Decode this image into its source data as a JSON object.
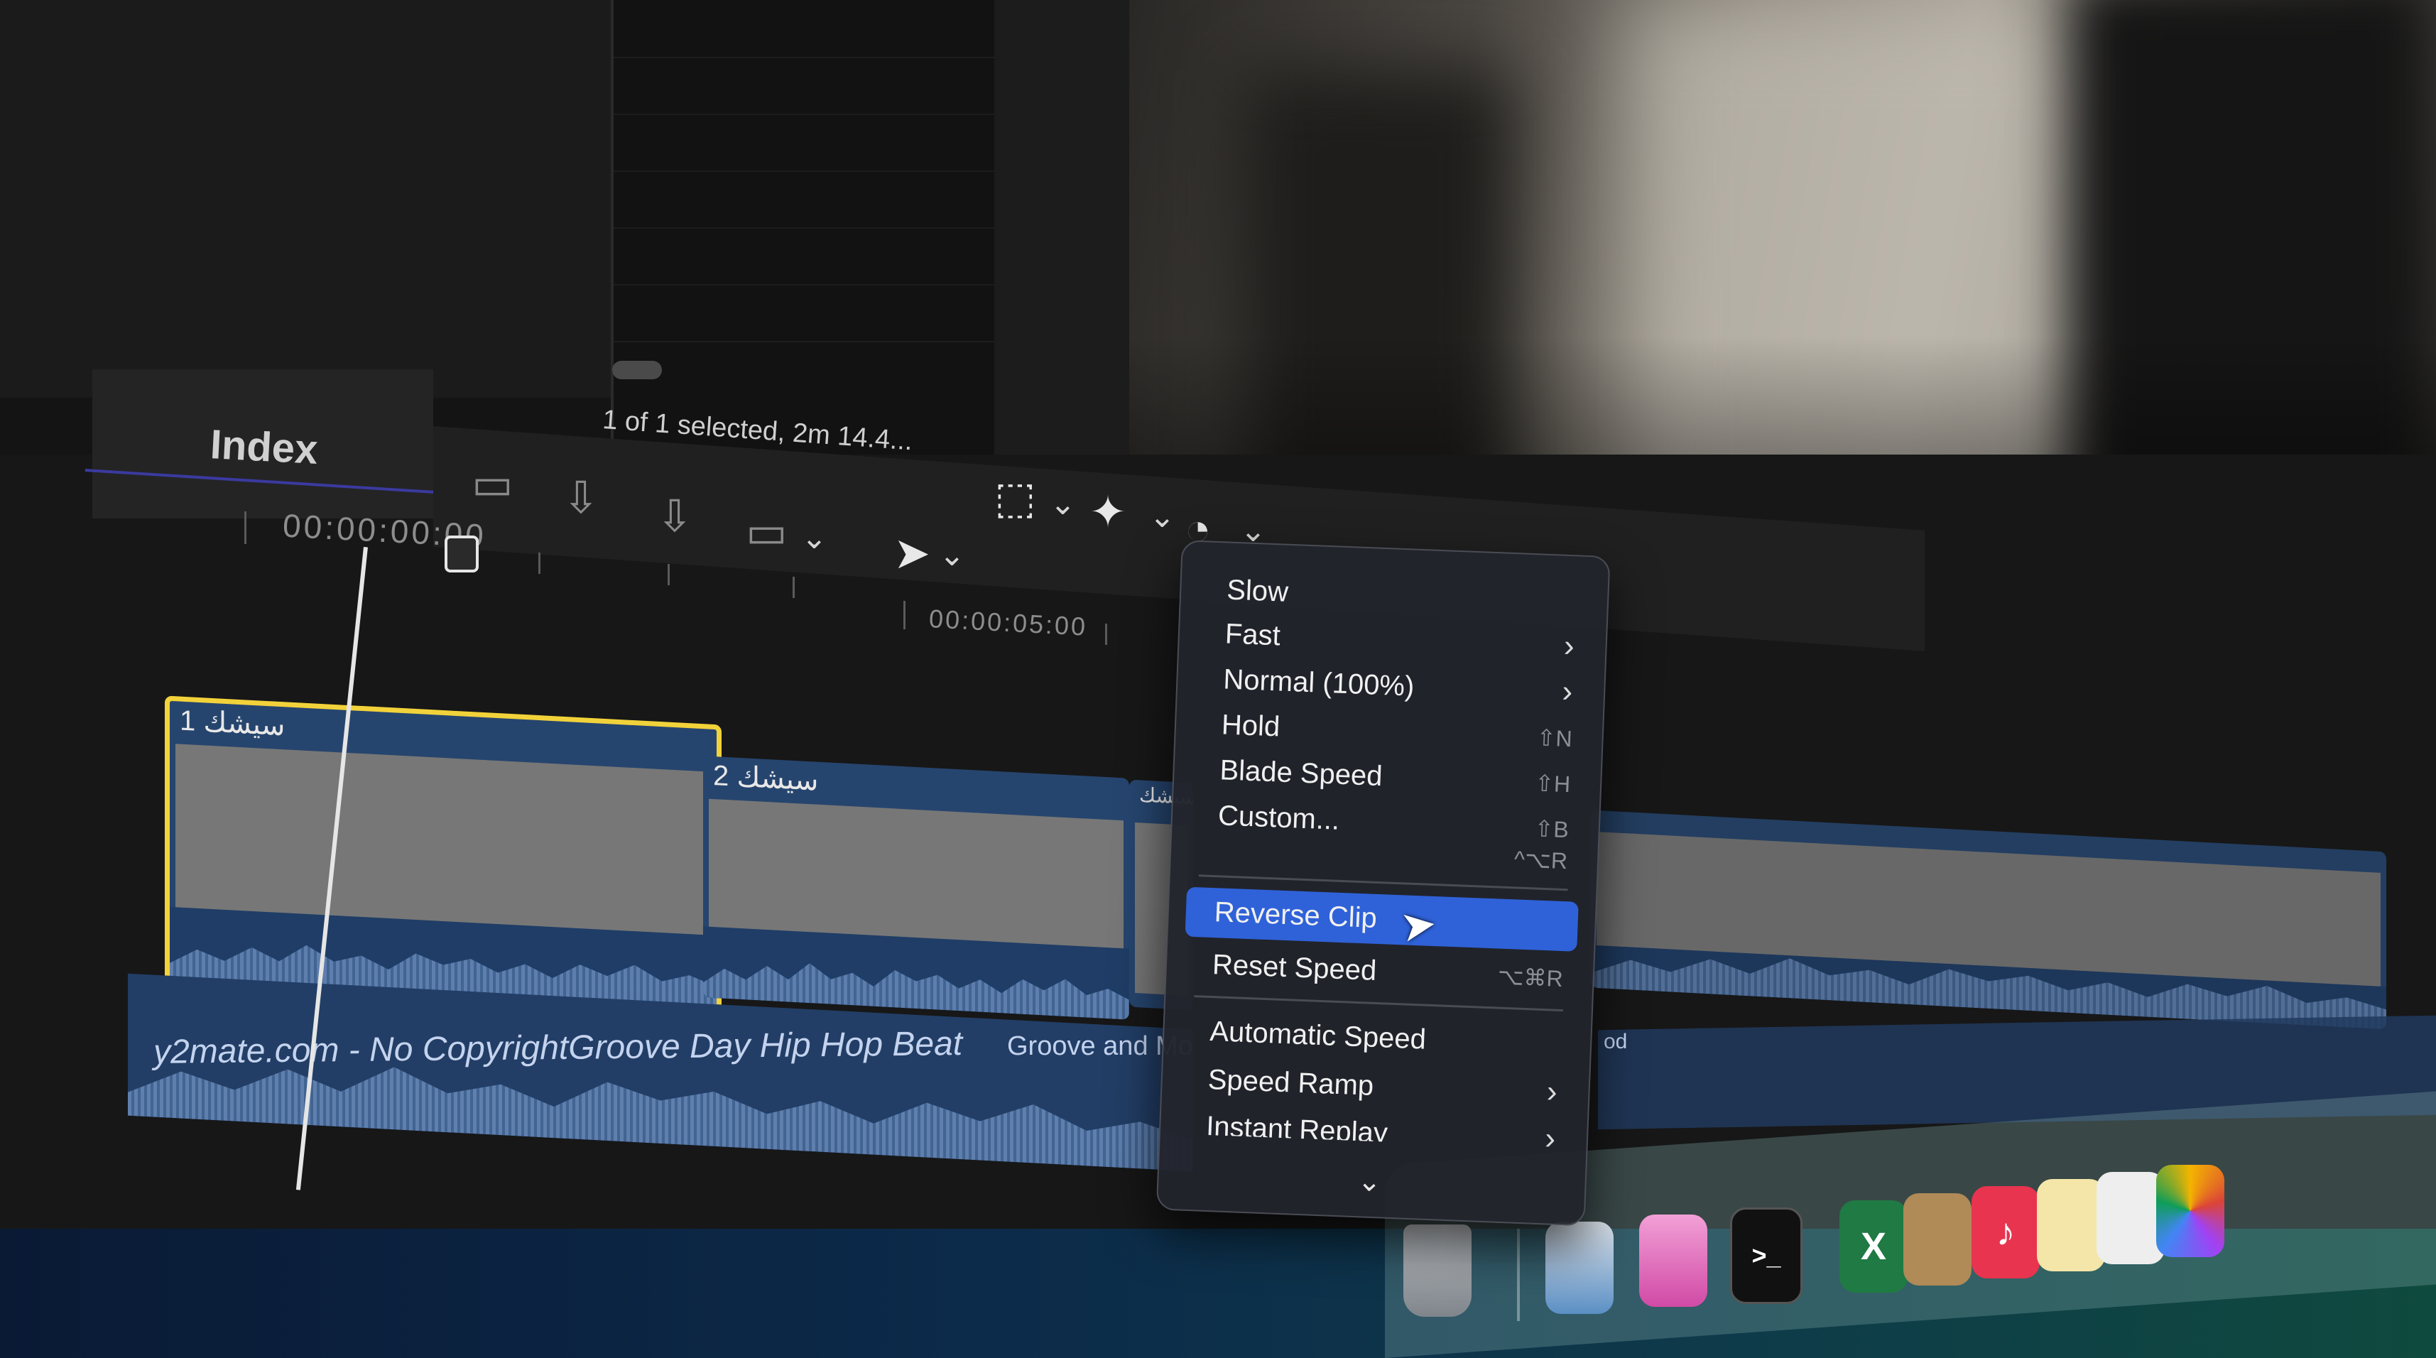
{
  "index_tab": {
    "label": "Index"
  },
  "browser": {
    "status": "1 of 1 selected, 2m 14.4..."
  },
  "timeline": {
    "timecode_start": "00:00:00:00",
    "timecode_5s": "00:00:05:00",
    "clips": [
      {
        "label": "سيشك 1"
      },
      {
        "label": "سيشك 2"
      },
      {
        "label": "سيشك"
      }
    ],
    "music": {
      "title": "y2mate.com - No CopyrightGroove Day Hip Hop Beat",
      "subtitle": "Groove and Mo",
      "right_label": "od"
    }
  },
  "speed_menu": {
    "items": [
      {
        "label": "Slow",
        "shortcut": "",
        "submenu": false
      },
      {
        "label": "Fast",
        "shortcut": "",
        "submenu": true
      },
      {
        "label": "Normal (100%)",
        "shortcut": "",
        "submenu": true
      },
      {
        "label": "Hold",
        "shortcut": "⇧N",
        "submenu": false
      },
      {
        "label": "Blade Speed",
        "shortcut": "⇧H",
        "submenu": false
      },
      {
        "label": "Custom...",
        "shortcut": "⇧B",
        "submenu": false
      },
      {
        "label": "",
        "shortcut": "^⌥R",
        "submenu": false
      },
      {
        "label": "Reverse Clip",
        "shortcut": "",
        "submenu": false,
        "highlighted": true
      },
      {
        "label": "Reset Speed",
        "shortcut": "⌥⌘R",
        "submenu": false
      },
      {
        "label": "Automatic Speed",
        "shortcut": "",
        "submenu": false
      },
      {
        "label": "Speed Ramp",
        "shortcut": "",
        "submenu": true
      },
      {
        "label": "Instant Replay",
        "shortcut": "",
        "submenu": true
      }
    ]
  },
  "dock": {
    "icons": [
      "trash-icon",
      "preview-icon",
      "cleanmymac-icon",
      "terminal-icon",
      "excel-icon",
      "archive-icon",
      "music-icon",
      "notes-icon",
      "pages-icon",
      "photos-icon"
    ],
    "excel_glyph": "X",
    "terminal_glyph": ">_"
  },
  "colors": {
    "accent": "#2f62d8",
    "selection": "#f2d23a",
    "clip": "#26456e"
  }
}
